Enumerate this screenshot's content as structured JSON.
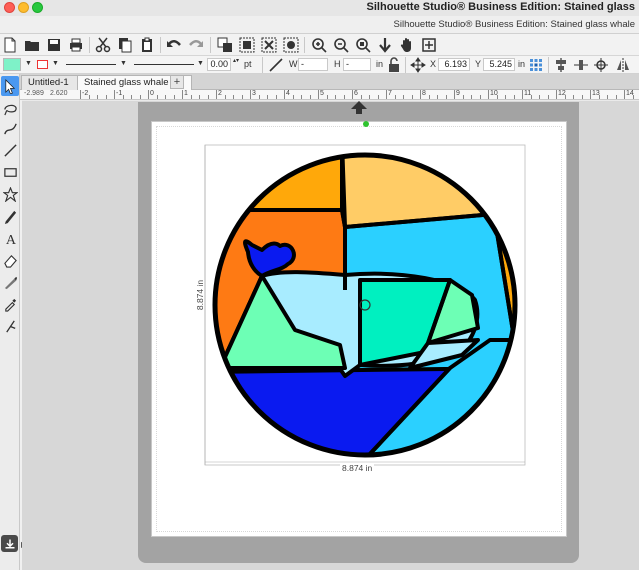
{
  "window": {
    "app_title": "Silhouette Studio® Business Edition: Stained glass",
    "doc_title": "Silhouette Studio® Business Edition: Stained glass whale"
  },
  "toolbar": {
    "icons": [
      "new-document-icon",
      "open-folder-icon",
      "save-icon",
      "print-icon",
      "cut-icon",
      "copy-icon",
      "paste-icon",
      "undo-icon",
      "redo-icon",
      "group-icon",
      "ungroup-icon",
      "release-icon",
      "zoom-in-icon",
      "zoom-out-icon",
      "zoom-selection-icon",
      "pan-down-icon",
      "hand-icon",
      "fit-page-icon"
    ]
  },
  "properties": {
    "fill_color": "#7ef2c8",
    "line_color": "#ee3333",
    "line_width": "0.00",
    "line_unit": "pt",
    "width_label": "W",
    "width_value": "-",
    "height_label": "H",
    "height_value": "-",
    "size_unit": "in",
    "x_label": "X",
    "x_value": "6.193",
    "y_label": "Y",
    "y_value": "5.245",
    "pos_unit": "in"
  },
  "tabs": [
    {
      "label": "Untitled-1"
    },
    {
      "label": "Stained glass whale"
    }
  ],
  "add_tab": "+",
  "ruler": {
    "coord_x": "-2.989",
    "coord_y": "2.620",
    "labels": [
      "-2",
      "-1",
      "0",
      "1",
      "2",
      "3",
      "4",
      "5",
      "6",
      "7",
      "8",
      "9",
      "10",
      "11",
      "12",
      "13",
      "14"
    ]
  },
  "canvas": {
    "dim_width": "8.874 in",
    "dim_height": "8.874 in",
    "colors": {
      "orange": "#ffa80a",
      "light_orange": "#ffcc66",
      "dark_orange": "#fe7a14",
      "cyan": "#2bd0ff",
      "whale_light": "#a8ecff",
      "mint": "#6dffb5",
      "sea_green": "#00f0c0",
      "blue": "#0a1af0",
      "outline": "#000000"
    }
  }
}
